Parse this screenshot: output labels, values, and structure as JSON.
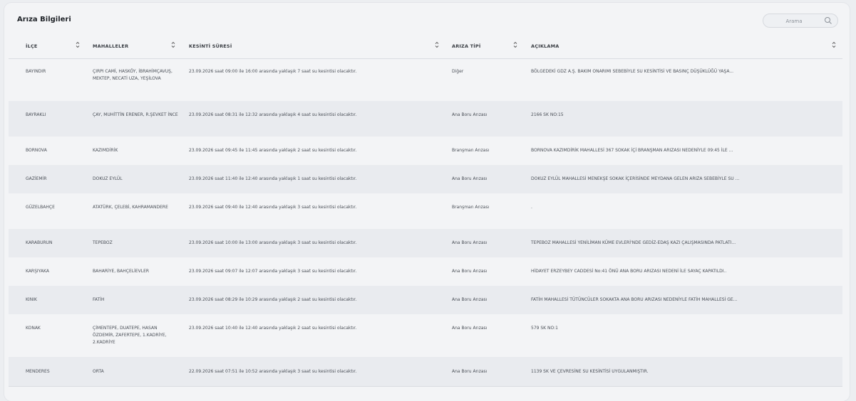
{
  "page": {
    "title": "Arıza Bilgileri"
  },
  "search": {
    "placeholder": "Arama",
    "value": ""
  },
  "columns": [
    "İLÇE",
    "MAHALLELER",
    "KESİNTİ SÜRESİ",
    "ARIZA TİPİ",
    "AÇIKLAMA"
  ],
  "rows": [
    {
      "ilce": "BAYINDIR",
      "mahalleler": "ÇIRPI CAMİ, HASKÖY, İBRAHİMÇAVUŞ, MEKTEP, NECATİ UZA, YEŞİLOVA",
      "sure": "23.09.2026 saat 09:00 ile 16:00 arasında yaklaşık 7 saat su kesintisi olacaktır.",
      "tip": "Diğer",
      "aciklama": "BÖLGEDEKİ GDZ A.Ş. BAKIM ONARIMI SEBEBİYLE SU KESİNTİSİ VE BASINÇ DÜŞÜKLÜĞÜ YAŞA..."
    },
    {
      "ilce": "BAYRAKLI",
      "mahalleler": "ÇAY, MUHİTTİN ERENER, R.ŞEVKET İNCE",
      "sure": "23.09.2026 saat 08:31 ile 12:32 arasında yaklaşık 4 saat su kesintisi olacaktır.",
      "tip": "Ana Boru Arızası",
      "aciklama": "2166 SK NO:15"
    },
    {
      "ilce": "BORNOVA",
      "mahalleler": "KAZIMDİRİK",
      "sure": "23.09.2026 saat 09:45 ile 11:45 arasında yaklaşık 2 saat su kesintisi olacaktır.",
      "tip": "Branşman Arızası",
      "aciklama": "BORNOVA KAZIMDİRİK MAHALLESİ 367 SOKAK İÇİ BRANŞMAN ARIZASI NEDENİYLE 09:45 İLE ..."
    },
    {
      "ilce": "GAZİEMİR",
      "mahalleler": "DOKUZ EYLÜL",
      "sure": "23.09.2026 saat 11:40 ile 12:40 arasında yaklaşık 1 saat su kesintisi olacaktır.",
      "tip": "Ana Boru Arızası",
      "aciklama": "DOKUZ EYLÜL MAHALLESİ MENEKŞE SOKAK İÇERİSİNDE MEYDANA GELEN ARIZA SEBEBİYLE SU ..."
    },
    {
      "ilce": "GÜZELBAHÇE",
      "mahalleler": "ATATÜRK, ÇELEBİ, KAHRAMANDERE",
      "sure": "23.09.2026 saat 09:40 ile 12:40 arasında yaklaşık 3 saat su kesintisi olacaktır.",
      "tip": "Branşman Arızası",
      "aciklama": "."
    },
    {
      "ilce": "KARABURUN",
      "mahalleler": "TEPEBOZ",
      "sure": "23.09.2026 saat 10:00 ile 13:00 arasında yaklaşık 3 saat su kesintisi olacaktır.",
      "tip": "Ana Boru Arızası",
      "aciklama": "TEPEBOZ MAHALLESİ YENİLİMAN KÜME EVLERİ'NDE GEDİZ-EDAŞ KAZI ÇALIŞMASINDA PATLATI..."
    },
    {
      "ilce": "KARŞIYAKA",
      "mahalleler": "BAHARİYE, BAHÇELİEVLER",
      "sure": "23.09.2026 saat 09:07 ile 12:07 arasında yaklaşık 3 saat su kesintisi olacaktır.",
      "tip": "Ana Boru Arızası",
      "aciklama": "HİDAYET ERZEYBEY CADDESİ No:41 ÖNÜ ANA BORU ARIZASI NEDENİ İLE SAYAÇ KAPATILDI.."
    },
    {
      "ilce": "KINIK",
      "mahalleler": "FATİH",
      "sure": "23.09.2026 saat 08:29 ile 10:29 arasında yaklaşık 2 saat su kesintisi olacaktır.",
      "tip": "Ana Boru Arızası",
      "aciklama": "FATİH MAHALLESİ TÜTÜNCÜLER SOKAKTA ANA BORU ARIZASI NEDENİYLE FATİH MAHALLESİ GE..."
    },
    {
      "ilce": "KONAK",
      "mahalleler": "ÇİMENTEPE, DUATEPE, HASAN ÖZDEMİR, ZAFERTEPE, 1.KADRİYE, 2.KADRİYE",
      "sure": "23.09.2026 saat 10:40 ile 12:40 arasında yaklaşık 2 saat su kesintisi olacaktır.",
      "tip": "Ana Boru Arızası",
      "aciklama": "579 SK NO:1"
    },
    {
      "ilce": "MENDERES",
      "mahalleler": "ORTA",
      "sure": "22.09.2026 saat 07:51 ile 10:52 arasında yaklaşık 3 saat su kesintisi olacaktır.",
      "tip": "Ana Boru Arızası",
      "aciklama": "1139 SK VE ÇEVRESİNE SU KESİNTİSİ UYGULANMIŞTIR."
    }
  ]
}
